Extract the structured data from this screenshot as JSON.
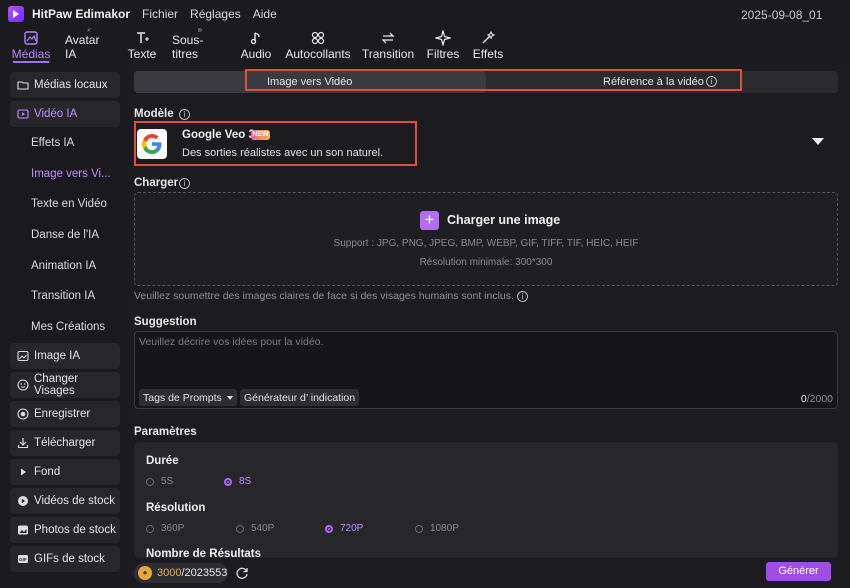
{
  "app": {
    "title": "HitPaw Edimakor",
    "menus": [
      "Fichier",
      "Réglages",
      "Aide"
    ],
    "project_name": "2025-09-08_01"
  },
  "toolbar": {
    "tabs": [
      {
        "label": "Médias",
        "icon": "media-icon"
      },
      {
        "label": "Avatar IA",
        "icon": "avatar-icon"
      },
      {
        "label": "Texte",
        "icon": "text-icon"
      },
      {
        "label": "Sous-titres",
        "icon": "subtitles-icon"
      },
      {
        "label": "Audio",
        "icon": "music-note-icon"
      },
      {
        "label": "Autocollants",
        "icon": "stickers-icon"
      },
      {
        "label": "Transition",
        "icon": "transition-icon"
      },
      {
        "label": "Filtres",
        "icon": "filters-icon"
      },
      {
        "label": "Effets",
        "icon": "effects-icon"
      }
    ],
    "active_tab": "Médias"
  },
  "sidebar": {
    "medias_locaux": "Médias locaux",
    "video_ia": "Vidéo IA",
    "sub_items": [
      "Effets IA",
      "Image vers Vi...",
      "Texte en Vidéo",
      "Danse de l'IA",
      "Animation IA",
      "Transition IA",
      "Mes Créations"
    ],
    "active_sub": "Image vers Vi...",
    "bottom_items": [
      {
        "label": "Image IA",
        "icon": "image-ai-icon"
      },
      {
        "label": "Changer Visages",
        "icon": "face-swap-icon"
      },
      {
        "label": "Enregistrer",
        "icon": "record-icon"
      },
      {
        "label": "Télécharger",
        "icon": "download-icon"
      },
      {
        "label": "Fond",
        "icon": "play-triangle-icon"
      },
      {
        "label": "Vidéos de stock",
        "icon": "stock-video-icon"
      },
      {
        "label": "Photos de stock",
        "icon": "stock-photo-icon"
      },
      {
        "label": "GIFs de stock",
        "icon": "gif-icon"
      }
    ]
  },
  "mode": {
    "tab_image_to_video": "Image vers Vidéo",
    "tab_reference": "Référence à la vidéo",
    "active": "Image vers Vidéo"
  },
  "model": {
    "section_label": "Modèle",
    "name": "Google Veo 3",
    "badge": "NEW",
    "description": "Des sorties réalistes avec un son naturel."
  },
  "upload": {
    "section_label": "Charger",
    "button_label": "Charger une image",
    "support": "Support : JPG, PNG, JPEG, BMP, WEBP, GIF, TIFF, TIF, HEIC, HEIF",
    "min_resolution": "Résolution minimale: 300*300",
    "hint": "Veuillez soumettre des images claires de face si des visages humains sont inclus."
  },
  "prompt": {
    "section_label": "Suggestion",
    "placeholder": "Veuillez décrire vos idées pour la vidéo.",
    "tags_button": "Tags de Prompts",
    "generator_button": "Générateur d’ indication",
    "count_current": "0",
    "count_max": "/2000"
  },
  "params": {
    "section_label": "Paramètres",
    "duration_label": "Durée",
    "durations": [
      "5S",
      "8S"
    ],
    "duration_selected": "8S",
    "resolution_label": "Résolution",
    "resolutions": [
      "360P",
      "540P",
      "720P",
      "1080P"
    ],
    "resolution_selected": "720P",
    "results_label": "Nombre de Résultats"
  },
  "footer": {
    "credits_used": "3000",
    "credits_total": "/2023553",
    "generate_label": "Générer"
  },
  "colors": {
    "accent": "#a04de8",
    "accent_text": "#c48cff",
    "highlight_box": "#e0503a"
  }
}
